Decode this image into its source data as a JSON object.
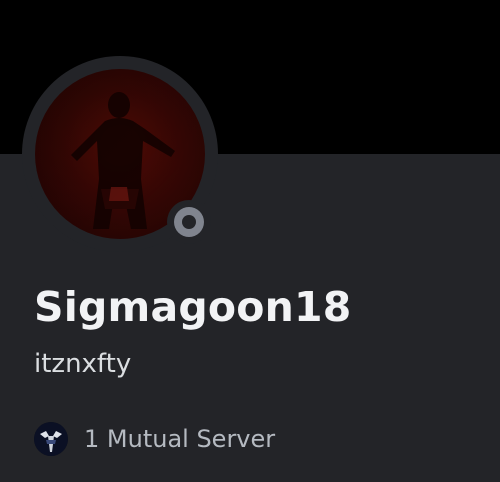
{
  "profile": {
    "display_name": "Sigmagoon18",
    "username": "itznxfty",
    "status": "offline",
    "avatar_icon": "user-avatar-image",
    "colors": {
      "background": "#232428",
      "banner": "#000000",
      "status_offline": "#80848e",
      "display_name_text": "#f2f3f5",
      "secondary_text": "#b5bac1"
    }
  },
  "mutual_servers": {
    "label": "1 Mutual Server",
    "server_icon": "server-icon"
  }
}
